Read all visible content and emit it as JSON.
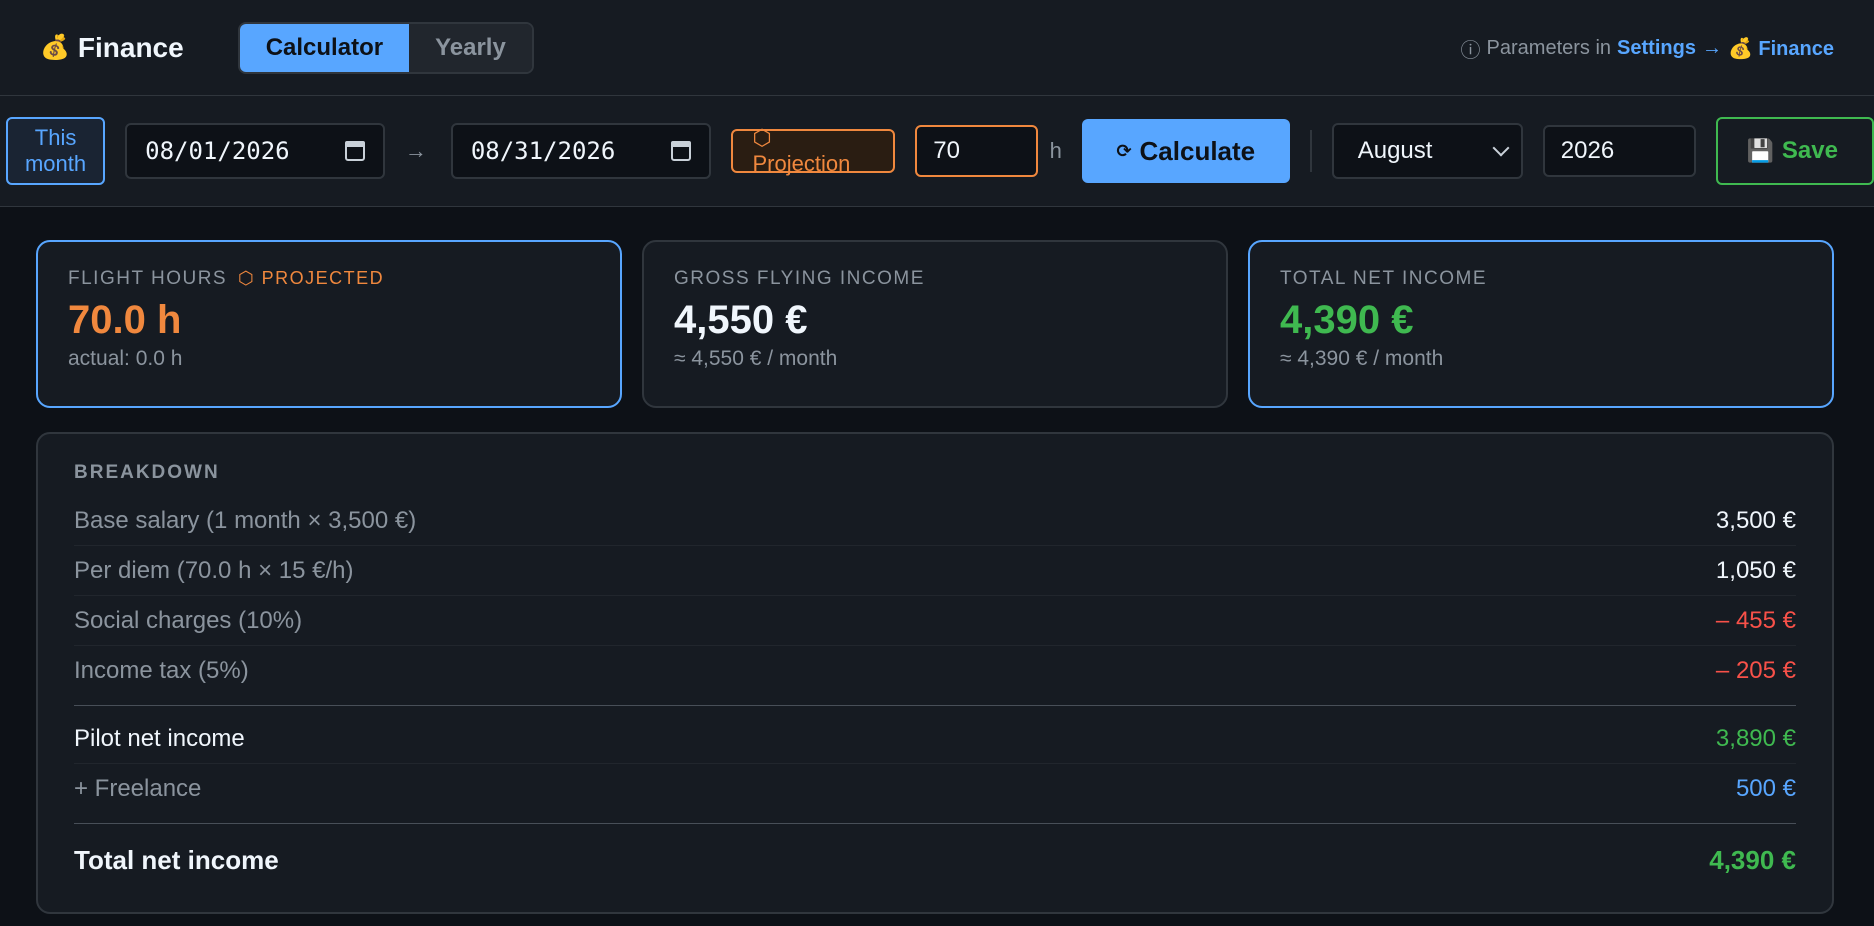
{
  "header": {
    "app_emoji": "💰",
    "app_title": "Finance",
    "tabs": [
      {
        "label": "Calculator",
        "active": true
      },
      {
        "label": "Yearly",
        "active": false
      }
    ],
    "params_info_icon": "ⓘ",
    "params_prefix": "Parameters in",
    "params_link_settings": "Settings",
    "params_arrow": "→",
    "params_link_finance": "💰 Finance"
  },
  "toolbar": {
    "this_month_line1": "This",
    "this_month_line2": "month",
    "date_from": "08/01/2026",
    "range_arrow": "→",
    "date_to": "08/31/2026",
    "projection_label": "⬡ Projection",
    "hours_value": "70",
    "hours_unit": "h",
    "calculate_icon": "⟳",
    "calculate_label": "Calculate",
    "month_selected": "August",
    "year_value": "2026",
    "save_icon": "💾",
    "save_label": "Save"
  },
  "cards": {
    "flight_hours": {
      "label": "FLIGHT HOURS",
      "projected_badge": "⬡ PROJECTED",
      "value": "70.0 h",
      "sub": "actual: 0.0 h"
    },
    "gross": {
      "label": "GROSS FLYING INCOME",
      "value": "4,550 €",
      "sub": "≈ 4,550 € / month"
    },
    "net": {
      "label": "TOTAL NET INCOME",
      "value": "4,390 €",
      "sub": "≈ 4,390 € / month"
    }
  },
  "breakdown": {
    "title": "BREAKDOWN",
    "rows": [
      {
        "label": "Base salary (1 month × 3,500 €)",
        "value": "3,500 €"
      },
      {
        "label": "Per diem (70.0 h × 15 €/h)",
        "value": "1,050 €"
      },
      {
        "label": "Social charges (10%)",
        "value": "– 455 €"
      },
      {
        "label": "Income tax (5%)",
        "value": "– 205 €"
      }
    ],
    "pilot_net": {
      "label": "Pilot net income",
      "value": "3,890 €"
    },
    "freelance": {
      "label": "+ Freelance",
      "value": "500 €"
    },
    "total": {
      "label": "Total net income",
      "value": "4,390 €"
    }
  },
  "colors": {
    "accent": "#58a6ff",
    "projection": "#f0883e",
    "positive": "#3fb950",
    "negative": "#f85149",
    "background": "#0d1117",
    "surface": "#161b22"
  }
}
